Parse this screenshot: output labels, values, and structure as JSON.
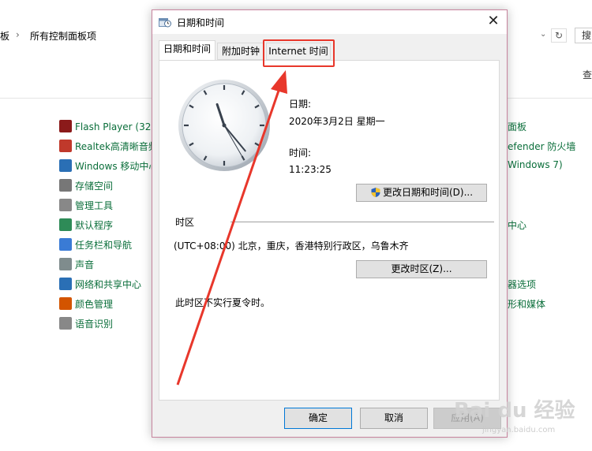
{
  "background": {
    "breadcrumb_part1": "板",
    "breadcrumb_sep": "›",
    "breadcrumb_part2": "所有控制面板项",
    "search_partial": "搜",
    "view_partial": "查",
    "left_items": [
      {
        "label": "Flash Player (32 位",
        "icon": "flash-icon",
        "color": "#8b1a1a"
      },
      {
        "label": "Realtek高清晰音频",
        "icon": "speaker-icon",
        "color": "#c0392b"
      },
      {
        "label": "Windows 移动中心",
        "icon": "mobility-icon",
        "color": "#2a6fb5"
      },
      {
        "label": "存储空间",
        "icon": "storage-icon",
        "color": "#777777"
      },
      {
        "label": "管理工具",
        "icon": "tools-icon",
        "color": "#888888"
      },
      {
        "label": "默认程序",
        "icon": "default-programs-icon",
        "color": "#2e8b57"
      },
      {
        "label": "任务栏和导航",
        "icon": "taskbar-icon",
        "color": "#3a7bd5"
      },
      {
        "label": "声音",
        "icon": "sound-icon",
        "color": "#7f8c8d"
      },
      {
        "label": "网络和共享中心",
        "icon": "network-icon",
        "color": "#2a6fb5"
      },
      {
        "label": "颜色管理",
        "icon": "color-management-icon",
        "color": "#d35400"
      },
      {
        "label": "语音识别",
        "icon": "microphone-icon",
        "color": "#888888"
      }
    ],
    "right_items": [
      {
        "label": "面板"
      },
      {
        "label": "efender 防火墙"
      },
      {
        "label": "Windows 7)"
      },
      {
        "label": "中心"
      },
      {
        "label": "器选项"
      },
      {
        "label": "形和媒体"
      }
    ]
  },
  "dialog": {
    "title": "日期和时间",
    "close_glyph": "✕",
    "tabs": [
      "日期和时间",
      "附加时钟",
      "Internet 时间"
    ],
    "active_tab": 0,
    "date_label": "日期:",
    "date_value": "2020年3月2日 星期一",
    "time_label": "时间:",
    "time_value": "11:23:25",
    "change_datetime_button": "更改日期和时间(D)...",
    "timezone_section": "时区",
    "timezone_value": "(UTC+08:00) 北京，重庆，香港特别行政区，乌鲁木齐",
    "change_timezone_button": "更改时区(Z)...",
    "dst_note": "此时区不实行夏令时。",
    "ok_button": "确定",
    "cancel_button": "取消",
    "apply_button": "应用(A)",
    "clock": {
      "hour": 11,
      "minute": 23,
      "second": 25
    }
  },
  "annotation": {
    "color": "#e8372b"
  },
  "watermark": {
    "text": "Bai du 经验",
    "sub": "jingyan.baidu.com"
  }
}
